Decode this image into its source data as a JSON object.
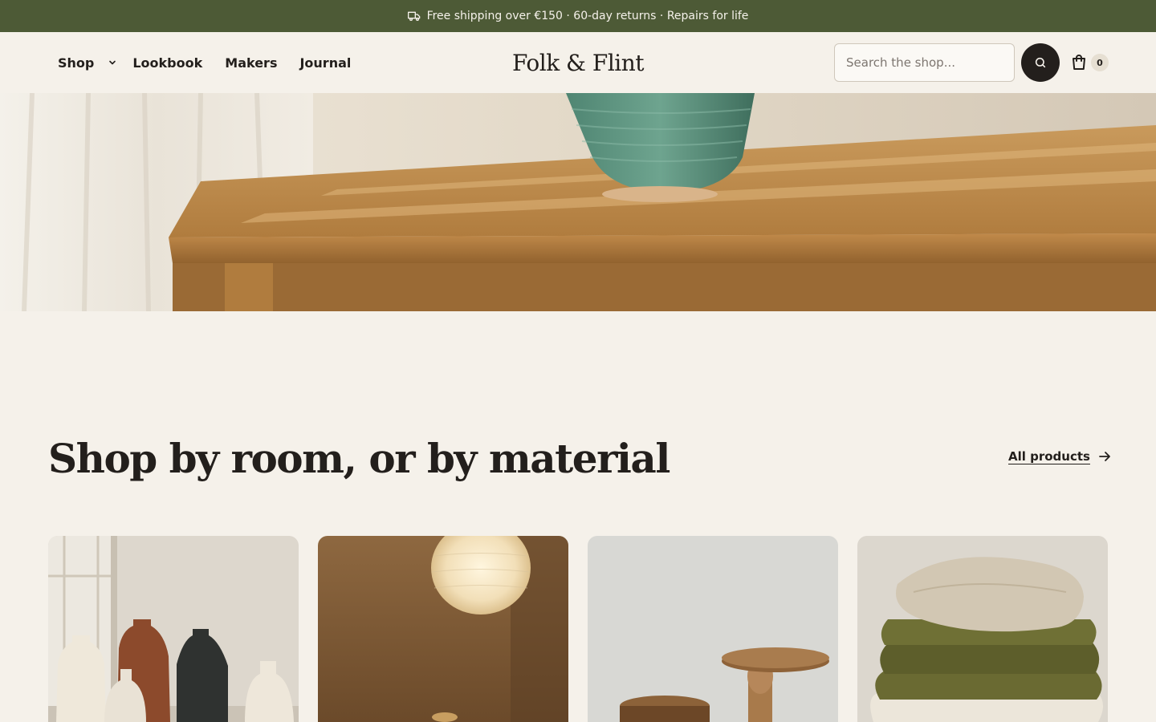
{
  "announcement": {
    "icon": "truck-icon",
    "text": "Free shipping over €150 · 60-day returns · Repairs for life"
  },
  "header": {
    "nav": [
      {
        "label": "Shop",
        "has_dropdown": true
      },
      {
        "label": "Lookbook"
      },
      {
        "label": "Makers"
      },
      {
        "label": "Journal"
      }
    ],
    "logo": "Folk & Flint",
    "search": {
      "placeholder": "Search the shop...",
      "value": ""
    },
    "search_button_icon": "search-icon",
    "cart_icon": "shopping-bag-icon",
    "cart_count": "0"
  },
  "hero": {
    "image": "sunlit wooden table with green ceramic vase"
  },
  "section": {
    "title": "Shop by room, or by material",
    "link_label": "All products",
    "link_icon": "arrow-right-icon"
  },
  "cards": [
    {
      "image": "ceramic vases by a window"
    },
    {
      "image": "paper pendant lamp in warm room"
    },
    {
      "image": "wooden side tables"
    },
    {
      "image": "stacked linen and wool textiles"
    }
  ],
  "colors": {
    "announcement_bg": "#4d5a36",
    "page_bg": "#f5f1ea",
    "text": "#231f1c",
    "search_button_bg": "#231f1c"
  }
}
